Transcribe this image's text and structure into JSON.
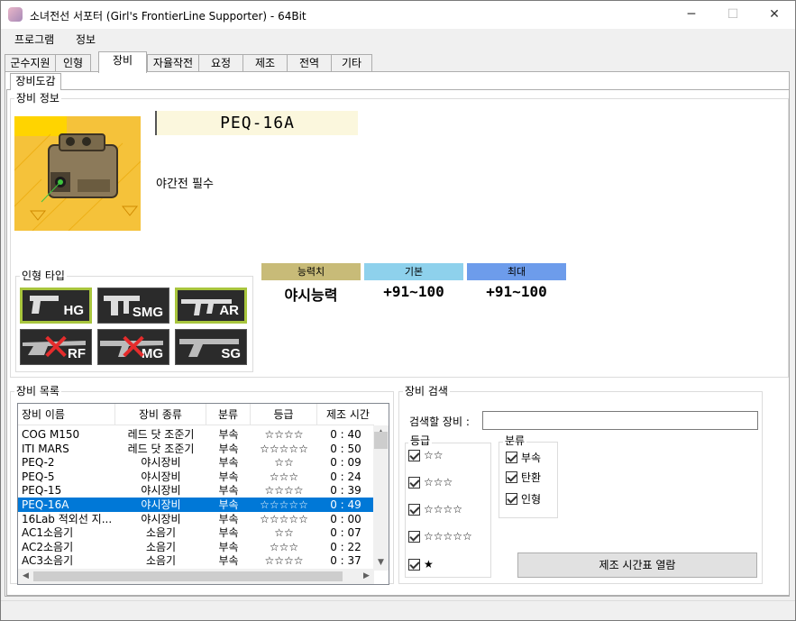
{
  "window": {
    "title": "소녀전선 서포터 (Girl's FrontierLine Supporter) - 64Bit",
    "minimize": "─",
    "maximize": "☐",
    "close": "✕"
  },
  "menu": [
    "프로그램",
    "정보"
  ],
  "tabs": [
    "군수지원",
    "인형",
    "장비",
    "자율작전",
    "요정",
    "제조",
    "전역",
    "기타"
  ],
  "subtab": "장비도감",
  "info": {
    "group_label": "장비 정보",
    "name": "PEQ-16A",
    "description": "야간전 필수"
  },
  "stats": {
    "headers": [
      "능력치",
      "기본",
      "최대"
    ],
    "values": [
      "야시능력",
      "+91~100",
      "+91~100"
    ],
    "colors": [
      "#c8bb78",
      "#8ed1ec",
      "#6d9ceb"
    ]
  },
  "doll_type": {
    "label": "인형 타입",
    "types": [
      "HG",
      "SMG",
      "AR",
      "RF",
      "MG",
      "SG"
    ],
    "enabled": [
      true,
      false,
      true,
      false,
      false,
      false
    ],
    "highlighted": [
      true,
      false,
      true,
      false,
      false,
      false
    ]
  },
  "list": {
    "label": "장비 목록",
    "columns": [
      "장비 이름",
      "장비 종류",
      "분류",
      "등급",
      "제조 시간"
    ],
    "rows": [
      [
        "COG M150",
        "레드 닷 조준기",
        "부속",
        "☆☆☆☆",
        "0 : 40"
      ],
      [
        "ITI MARS",
        "레드 닷 조준기",
        "부속",
        "☆☆☆☆☆",
        "0 : 50"
      ],
      [
        "PEQ-2",
        "야시장비",
        "부속",
        "☆☆",
        "0 : 09"
      ],
      [
        "PEQ-5",
        "야시장비",
        "부속",
        "☆☆☆",
        "0 : 24"
      ],
      [
        "PEQ-15",
        "야시장비",
        "부속",
        "☆☆☆☆",
        "0 : 39"
      ],
      [
        "PEQ-16A",
        "야시장비",
        "부속",
        "☆☆☆☆☆",
        "0 : 49"
      ],
      [
        "16Lab 적외선 지...",
        "야시장비",
        "부속",
        "☆☆☆☆☆",
        "0 : 00"
      ],
      [
        "AC1소음기",
        "소음기",
        "부속",
        "☆☆",
        "0 : 07"
      ],
      [
        "AC2소음기",
        "소음기",
        "부속",
        "☆☆☆",
        "0 : 22"
      ],
      [
        "AC3소음기",
        "소음기",
        "부속",
        "☆☆☆☆",
        "0 : 37"
      ]
    ],
    "selected": 5
  },
  "search": {
    "label": "장비 검색",
    "field_label": "검색할 장비 :",
    "grade_label": "등급",
    "grades": [
      "☆☆",
      "☆☆☆",
      "☆☆☆☆",
      "☆☆☆☆☆",
      "★"
    ],
    "class_label": "분류",
    "classes": [
      "부속",
      "탄환",
      "인형"
    ],
    "button": "제조 시간표 열람"
  }
}
